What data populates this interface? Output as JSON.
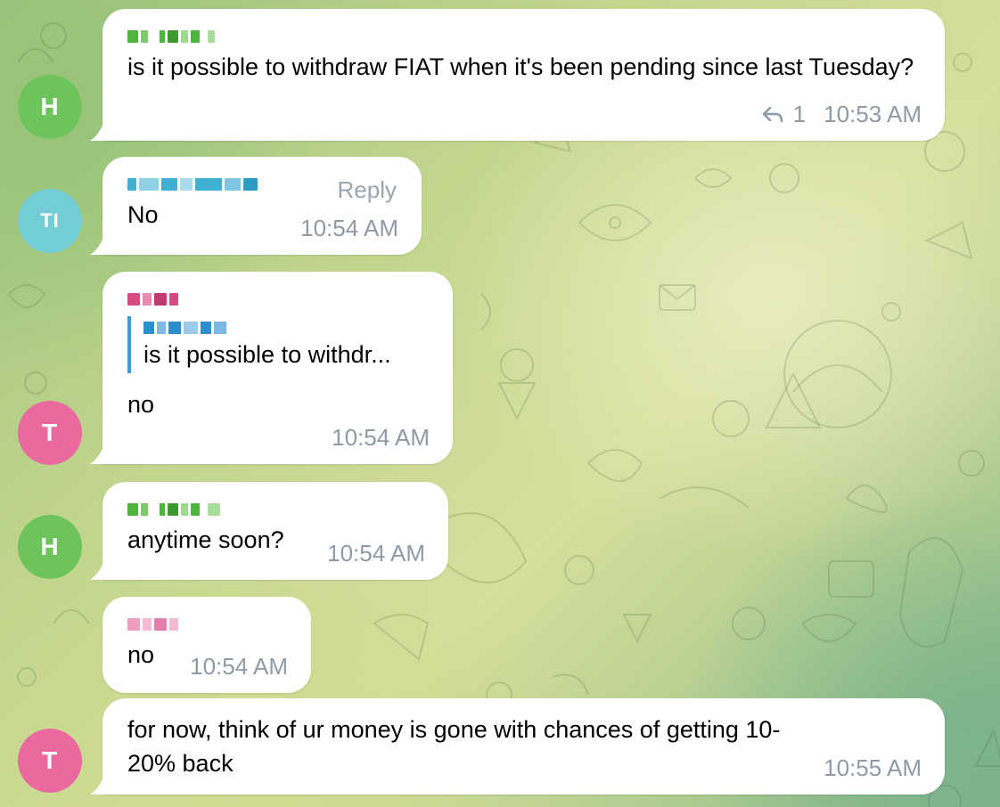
{
  "theme": {
    "green_avatar": "#6cc45a",
    "teal_avatar": "#73cdd6",
    "pink_avatar": "#ea6aa0",
    "time_color": "#8e9aa6",
    "quote_border": "#3a9bd6"
  },
  "messages": [
    {
      "avatar_initial": "H",
      "avatar_color": "green",
      "sender_name_pixelated": true,
      "text": "is it possible to withdraw FIAT when it's been pending since last Tuesday?",
      "reply_icon": "reply-arrow-icon",
      "reply_count": "1",
      "time": "10:53 AM"
    },
    {
      "avatar_initial": "TI",
      "avatar_color": "teal",
      "sender_name_pixelated": true,
      "reply_label": "Reply",
      "text": "No",
      "time": "10:54 AM"
    },
    {
      "avatar_initial": "T",
      "avatar_color": "pink",
      "sender_name_pixelated": true,
      "quoted_name_pixelated": true,
      "quoted_text": "is it possible to withdr...",
      "text": "no",
      "time": "10:54 AM"
    },
    {
      "avatar_initial": "H",
      "avatar_color": "green",
      "sender_name_pixelated": true,
      "text": "anytime soon?",
      "time": "10:54 AM"
    },
    {
      "avatar_color": "pink",
      "sender_name_pixelated": true,
      "text": "no",
      "time": "10:54 AM"
    },
    {
      "avatar_initial": "T",
      "avatar_color": "pink",
      "text": "for now, think of ur money is gone with chances of getting 10-20% back",
      "time": "10:55 AM"
    }
  ]
}
